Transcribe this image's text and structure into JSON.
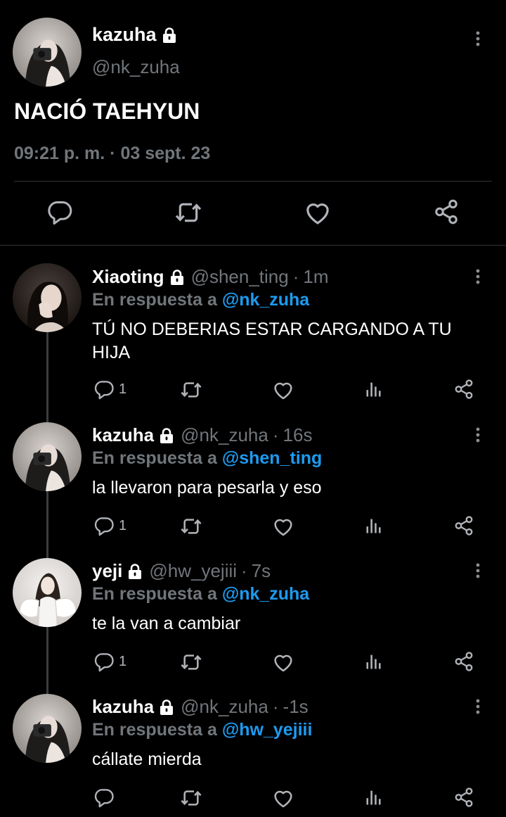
{
  "main_tweet": {
    "name": "kazuha",
    "handle": "@nk_zuha",
    "text": "NACIÓ TAEHYUN",
    "meta": "09:21 p. m. · 03 sept. 23",
    "icons": [
      "reply-icon",
      "retweet-icon",
      "like-icon",
      "share-icon"
    ]
  },
  "replies": [
    {
      "name": "Xiaoting",
      "handle": "@shen_ting",
      "dot": "·",
      "time": "1m",
      "in_reply_prefix": "En respuesta a",
      "in_reply_handle": "@nk_zuha",
      "text": "TÚ NO DEBERIAS ESTAR CARGANDO A TU HIJA",
      "reply_count": "1"
    },
    {
      "name": "kazuha",
      "handle": "@nk_zuha",
      "dot": "·",
      "time": "16s",
      "in_reply_prefix": "En respuesta a",
      "in_reply_handle": "@shen_ting",
      "text": "la llevaron para pesarla y eso",
      "reply_count": "1"
    },
    {
      "name": "yeji",
      "handle": "@hw_yejiii",
      "dot": "·",
      "time": "7s",
      "in_reply_prefix": "En respuesta a",
      "in_reply_handle": "@nk_zuha",
      "text": "te la van a cambiar",
      "reply_count": "1"
    },
    {
      "name": "kazuha",
      "handle": "@nk_zuha",
      "dot": "·",
      "time": "-1s",
      "in_reply_prefix": "En respuesta a",
      "in_reply_handle": "@hw_yejiii",
      "text": "cállate mierda",
      "reply_count": ""
    }
  ],
  "colors": {
    "background": "#000000",
    "text": "#e7e9ea",
    "muted": "#71767b",
    "link": "#1d9bf0",
    "divider": "#2f3336"
  }
}
